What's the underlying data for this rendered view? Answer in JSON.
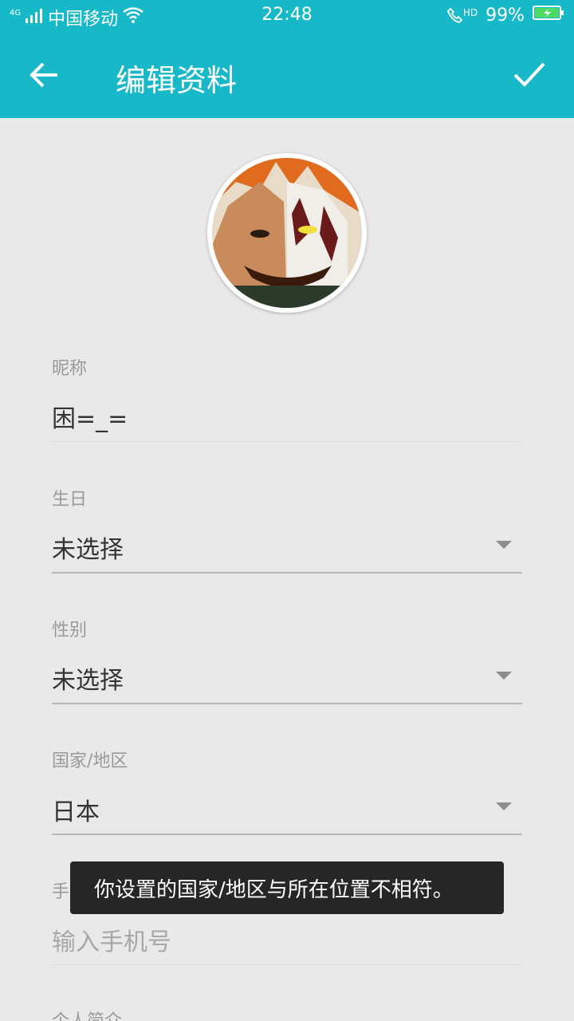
{
  "status_bar": {
    "network_type": "4G",
    "carrier": "中国移动",
    "time": "22:48",
    "call_badge": "HD",
    "battery": "99%"
  },
  "app_bar": {
    "title": "编辑资料",
    "back_icon": "arrow-left-icon",
    "confirm_icon": "check-icon",
    "color": "#17b8c8"
  },
  "profile": {
    "avatar_alt": "avatar",
    "nickname": {
      "label": "昵称",
      "value": "困=_="
    },
    "birthday": {
      "label": "生日",
      "value": "未选择"
    },
    "gender": {
      "label": "性别",
      "value": "未选择"
    },
    "country": {
      "label": "国家/地区",
      "value": "日本"
    },
    "phone": {
      "label": "手机号",
      "placeholder": "输入手机号"
    },
    "bio": {
      "label": "个人简介"
    }
  },
  "toast": {
    "text": "你设置的国家/地区与所在位置不相符。"
  }
}
